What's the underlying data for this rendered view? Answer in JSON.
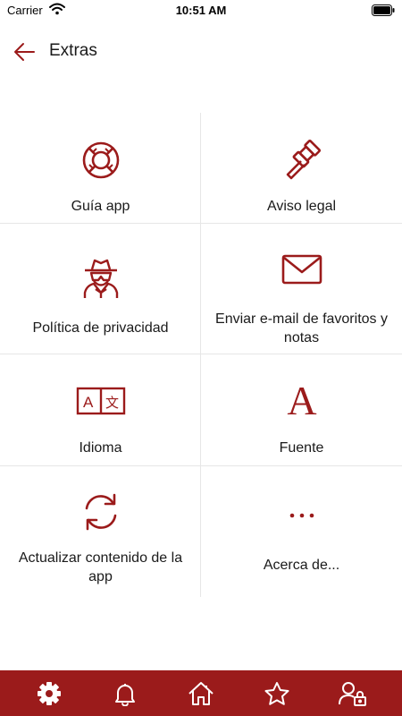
{
  "status_bar": {
    "carrier": "Carrier",
    "time": "10:51 AM"
  },
  "header": {
    "title": "Extras",
    "back_icon": "arrow-left-icon"
  },
  "colors": {
    "accent": "#9b1b1b",
    "tab_bar_background": "#9b1b1b",
    "tab_icon": "#ffffff"
  },
  "items": [
    {
      "label": "Guía app",
      "icon": "lifebuoy-icon"
    },
    {
      "label": "Aviso legal",
      "icon": "gavel-icon"
    },
    {
      "label": "Política de privacidad",
      "icon": "spy-icon"
    },
    {
      "label": "Enviar e-mail de favoritos y notas",
      "icon": "envelope-icon"
    },
    {
      "label": "Idioma",
      "icon": "translate-icon"
    },
    {
      "label": "Fuente",
      "icon": "font-icon"
    },
    {
      "label": "Actualizar contenido de la app",
      "icon": "refresh-icon"
    },
    {
      "label": "Acerca de...",
      "icon": "ellipsis-icon"
    }
  ],
  "tab_bar": [
    {
      "name": "settings",
      "icon": "gear-icon",
      "active": true
    },
    {
      "name": "notifications",
      "icon": "bell-icon",
      "active": false
    },
    {
      "name": "home",
      "icon": "home-icon",
      "active": false
    },
    {
      "name": "favorites",
      "icon": "star-icon",
      "active": false
    },
    {
      "name": "account",
      "icon": "user-lock-icon",
      "active": false
    }
  ]
}
